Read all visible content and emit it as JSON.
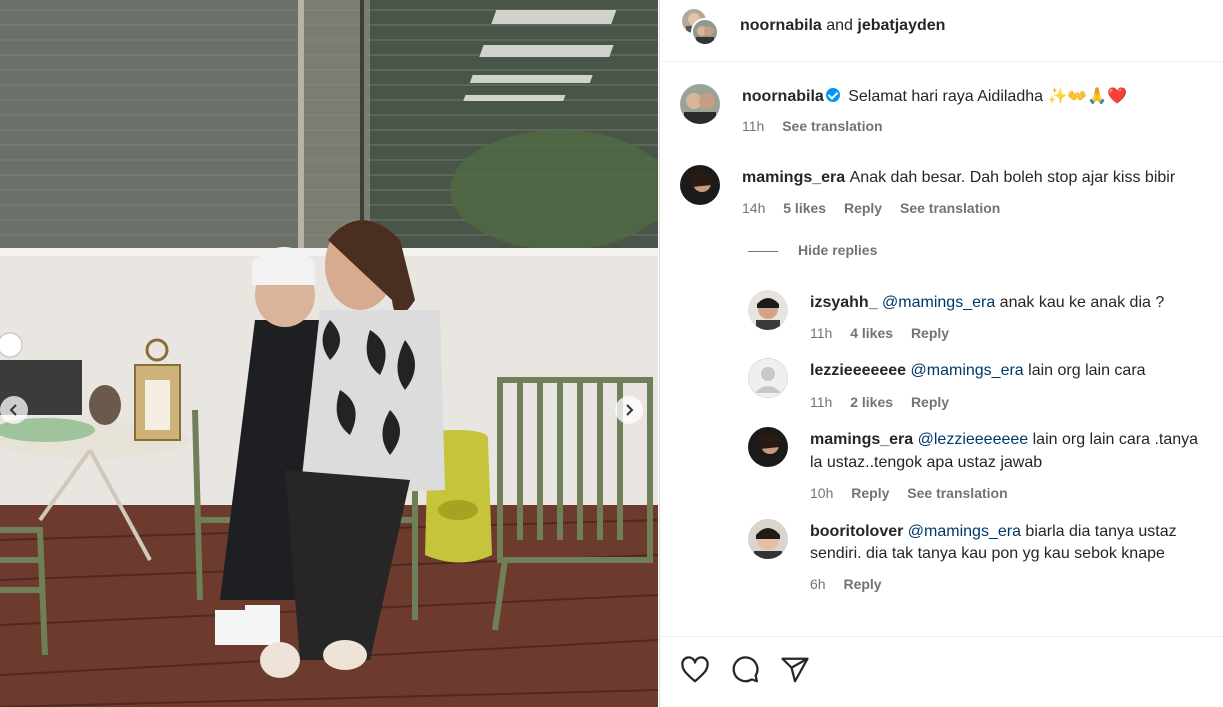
{
  "post": {
    "header_user1": "noornabila",
    "header_and": "and",
    "header_user2": "jebatjayden",
    "caption_user": "noornabila",
    "caption_text": "Selamat hari raya Aidiladha",
    "caption_emoji": "✨👐🙏❤️",
    "caption_time": "11h",
    "caption_see_translation": "See translation"
  },
  "comments": [
    {
      "user": "mamings_era",
      "text": "Anak dah besar. Dah boleh stop ajar kiss bibir",
      "time": "14h",
      "likes": "5 likes",
      "reply": "Reply",
      "see_translation": "See translation"
    }
  ],
  "hide_replies": "Hide replies",
  "replies": [
    {
      "user": "izsyahh_",
      "mention": "@mamings_era",
      "text": "anak kau ke anak dia ?",
      "time": "11h",
      "likes": "4 likes",
      "reply": "Reply"
    },
    {
      "user": "lezzieeeeeee",
      "mention": "@mamings_era",
      "text": "lain org lain cara",
      "time": "11h",
      "likes": "2 likes",
      "reply": "Reply"
    },
    {
      "user": "mamings_era",
      "mention": "@lezzieeeeeee",
      "text": "lain org lain cara .tanya",
      "text2": "la ustaz..tengok apa ustaz jawab",
      "time": "10h",
      "reply": "Reply",
      "see_translation": "See translation"
    },
    {
      "user": "booritolover",
      "mention": "@mamings_era",
      "text": "biarla dia tanya ustaz",
      "text2": "sendiri. dia tak tanya kau pon yg kau sebok knape",
      "time": "6h",
      "reply": "Reply"
    }
  ],
  "icons": {
    "like": "heart-icon",
    "comment": "comment-icon",
    "share": "share-icon",
    "prev": "chevron-left-icon",
    "next": "chevron-right-icon",
    "verified": "verified-badge-icon"
  },
  "colors": {
    "text": "#262626",
    "secondary": "#737373",
    "mention": "#00376b",
    "verified": "#0095f6"
  }
}
